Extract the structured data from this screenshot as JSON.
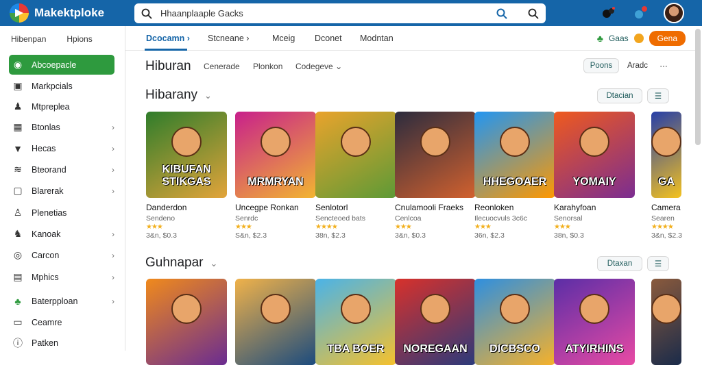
{
  "app": {
    "title": "Makektploke",
    "search_text": "Hhaanplaaple Gacks"
  },
  "sidebar": {
    "tabs": [
      "Hibenpan",
      "Hpions"
    ],
    "items": [
      {
        "label": "Abcoepacle",
        "icon": "gamepad-icon",
        "active": true
      },
      {
        "label": "Markpcials",
        "icon": "bag-icon"
      },
      {
        "label": "Mtpreplea",
        "icon": "person-icon"
      },
      {
        "label": "Btonlas",
        "icon": "grid-icon",
        "chevron": true
      },
      {
        "label": "Hecas",
        "icon": "diamond-icon",
        "chevron": true
      },
      {
        "label": "Bteorand",
        "icon": "wave-icon",
        "chevron": true
      },
      {
        "label": "Blarerak",
        "icon": "box-icon",
        "chevron": true
      },
      {
        "label": "Plenetias",
        "icon": "people-icon"
      },
      {
        "label": "Kanoak",
        "icon": "person-run-icon",
        "chevron": true
      },
      {
        "label": "Carcon",
        "icon": "pin-icon",
        "chevron": true
      },
      {
        "label": "Mphics",
        "icon": "film-icon",
        "chevron": true
      },
      {
        "label": "Baterpploan",
        "icon": "leaf-icon",
        "chevron": true
      },
      {
        "label": "Ceamre",
        "icon": "monitor-icon"
      },
      {
        "label": "Patken",
        "icon": "info-icon"
      }
    ]
  },
  "nav": {
    "tabs": [
      "Dcocamn",
      "Stcneane",
      "Mceig",
      "Dconet",
      "Modntan"
    ],
    "right_label": "Gaas",
    "button": "Gena"
  },
  "page": {
    "title": "Hiburan",
    "filters": [
      "Cenerade",
      "Plonkon",
      "Codegeve"
    ],
    "actions": [
      "Poons",
      "Aradc"
    ]
  },
  "sections": [
    {
      "title": "Hibarany",
      "action": "Dtacian",
      "cards": [
        {
          "name": "Danderdon",
          "sub": "Sendeno",
          "stars": "★★★",
          "price": "3&n, $0.3",
          "art": "KIBUFAN STIKGAS",
          "colors": [
            "#2f7d2b",
            "#e2a43a"
          ]
        },
        {
          "name": "Uncegpe Ronkan",
          "sub": "Senrdc",
          "stars": "★★★",
          "price": "S&n, $2.3",
          "art": "MRMRYAN",
          "colors": [
            "#c8208b",
            "#f2b531"
          ]
        },
        {
          "name": "Senlotorl",
          "sub": "Sencteoed bats",
          "stars": "★★★★",
          "price": "38n, $2.3",
          "art": "",
          "colors": [
            "#e9a32c",
            "#5d9a36"
          ]
        },
        {
          "name": "Cnulamooli Fraeks",
          "sub": "Cenlcoa",
          "stars": "★★★",
          "price": "3&n, $0.3",
          "art": "",
          "colors": [
            "#2c2c3e",
            "#d2612e"
          ]
        },
        {
          "name": "Reonloken",
          "sub": "Ilecuocvuls 3c6c",
          "stars": "★★★",
          "price": "36n, $2.3",
          "art": "HHEGOAER",
          "colors": [
            "#2196f3",
            "#ff9800"
          ]
        },
        {
          "name": "Karahyfoan",
          "sub": "Senorsal",
          "stars": "★★★",
          "price": "38n, $0.3",
          "art": "YOMAIY",
          "colors": [
            "#ef5a1e",
            "#7b2d91"
          ]
        },
        {
          "name": "Camera",
          "sub": "Searen",
          "stars": "★★★★",
          "price": "3&n, $2.3",
          "art": "GA",
          "colors": [
            "#263ea8",
            "#f4c21f"
          ]
        }
      ]
    },
    {
      "title": "Guhnapar",
      "action": "Dtaxan",
      "cards": [
        {
          "art": "",
          "colors": [
            "#f08a1c",
            "#6a2c91"
          ]
        },
        {
          "art": "",
          "colors": [
            "#f0b24a",
            "#1b4b7e"
          ]
        },
        {
          "art": "TBA BOER",
          "colors": [
            "#4ab3e8",
            "#f6c12c"
          ]
        },
        {
          "art": "NOREGAAN",
          "colors": [
            "#d8312b",
            "#2b3a7b"
          ]
        },
        {
          "art": "DICBSCO",
          "colors": [
            "#2e8fe0",
            "#f6b12a"
          ]
        },
        {
          "art": "ATYIRHINS",
          "colors": [
            "#5b2ea6",
            "#e84aa4"
          ]
        },
        {
          "art": "",
          "colors": [
            "#8a5a3c",
            "#1a2b4a"
          ]
        }
      ]
    }
  ],
  "colors": {
    "topbar": "#1565a8",
    "active": "#2e9a3e",
    "accent": "#ef6c00"
  }
}
